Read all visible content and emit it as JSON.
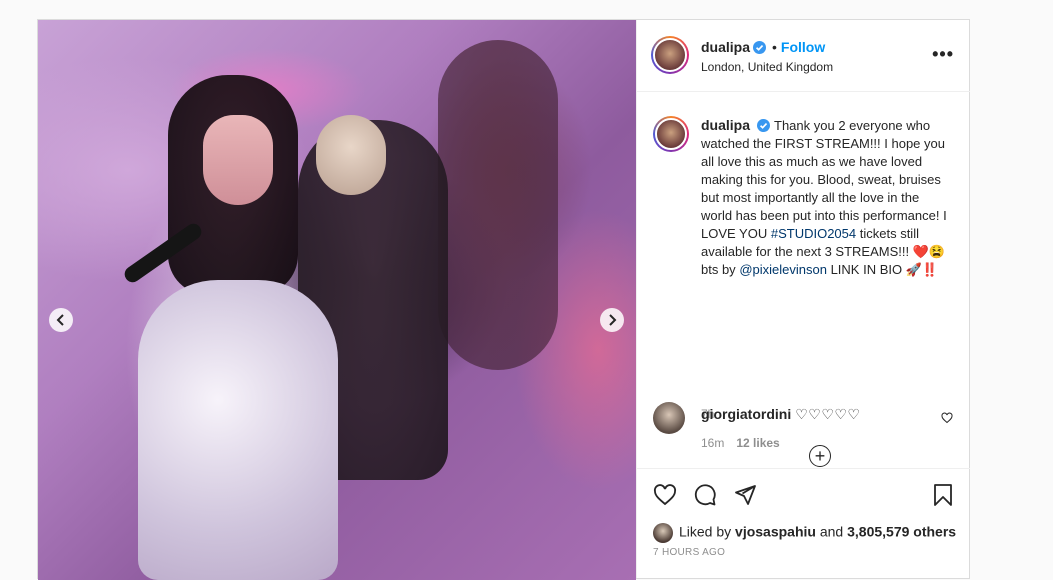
{
  "post": {
    "username": "dualipa",
    "follow_label": "Follow",
    "location": "London, United Kingdom",
    "more_icon": "more-options-icon",
    "caption": {
      "username": "dualipa",
      "text_before_hashtag": "Thank you 2 everyone who watched the FIRST STREAM!!! I hope you all love this as much as we have loved making this for you. Blood, sweat, bruises but most importantly all the love in the world has been put into this performance! I LOVE YOU",
      "hashtag": "#STUDIO2054",
      "text_after_hashtag": " tickets still available for the next 3 STREAMS!!! ❤️😫 bts by",
      "mention": "@pixielevinson",
      "text_end": " LINK IN BIO 🚀‼️"
    },
    "caption_time": "7h",
    "load_more_label": "+",
    "comments": [
      {
        "username": "giorgiatordini",
        "text": "♡♡♡♡♡",
        "time": "16m",
        "likes": "12 likes"
      }
    ],
    "liked_by_prefix": "Liked by",
    "liked_by_user": "vjosaspahiu",
    "liked_by_and": "and",
    "liked_by_count": "3,805,579 others",
    "post_time": "7 HOURS AGO"
  },
  "colors": {
    "accent": "#0095f6",
    "link": "#00376b",
    "muted": "#8e8e8e",
    "text": "#262626"
  }
}
